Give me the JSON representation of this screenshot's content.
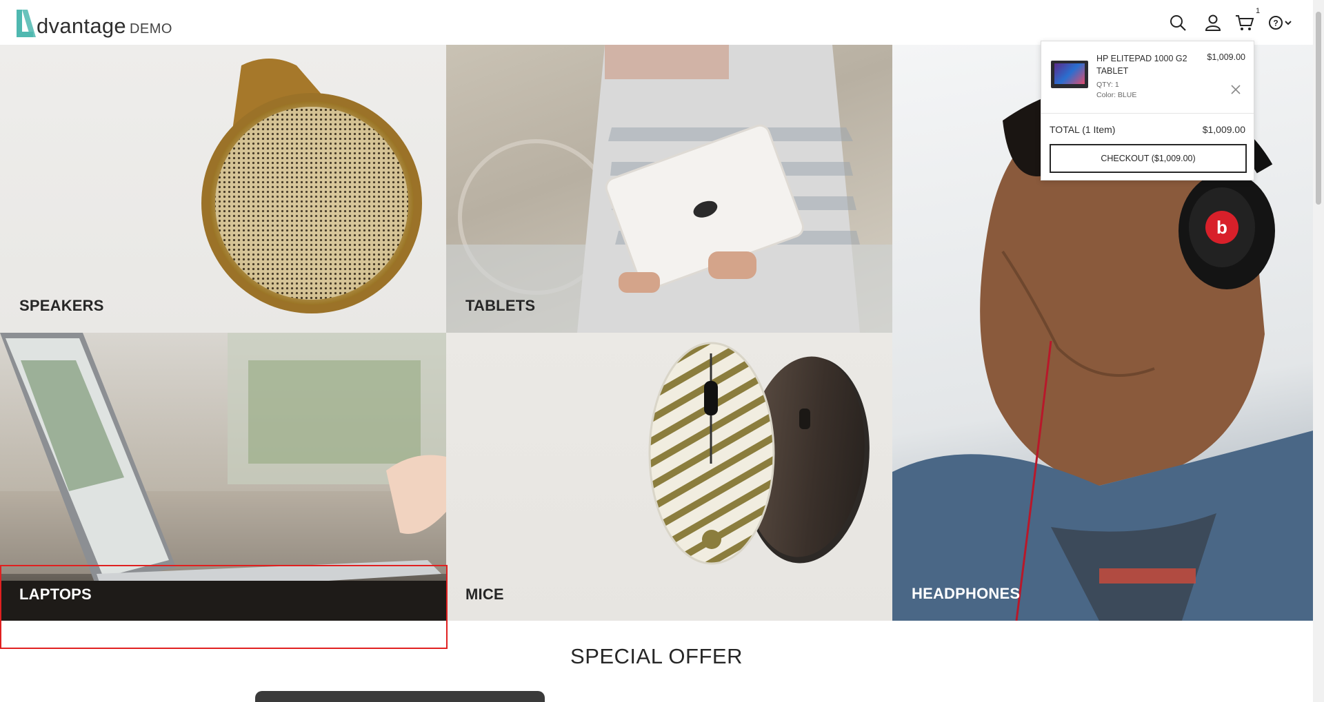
{
  "header": {
    "logo_letter": "A",
    "logo_text": "dvantage",
    "logo_suffix": "DEMO",
    "icons": [
      "search-icon",
      "user-icon",
      "cart-icon",
      "help-icon"
    ],
    "cart_count": "1"
  },
  "categories": [
    {
      "label": "SPEAKERS"
    },
    {
      "label": "TABLETS"
    },
    {
      "label": "LAPTOPS"
    },
    {
      "label": "MICE"
    },
    {
      "label": "HEADPHONES"
    }
  ],
  "special_offer": {
    "title": "SPECIAL OFFER"
  },
  "cart_popup": {
    "item": {
      "name": "HP ELITEPAD 1000 G2 TABLET",
      "price": "$1,009.00",
      "qty": "QTY: 1",
      "color": "Color: BLUE"
    },
    "total_label": "TOTAL (1 Item)",
    "total_value": "$1,009.00",
    "checkout_label": "CHECKOUT ($1,009.00)"
  },
  "colors": {
    "brand_teal": "#4fb8b0",
    "highlight_red": "#e02020",
    "text_dark": "#262626"
  }
}
